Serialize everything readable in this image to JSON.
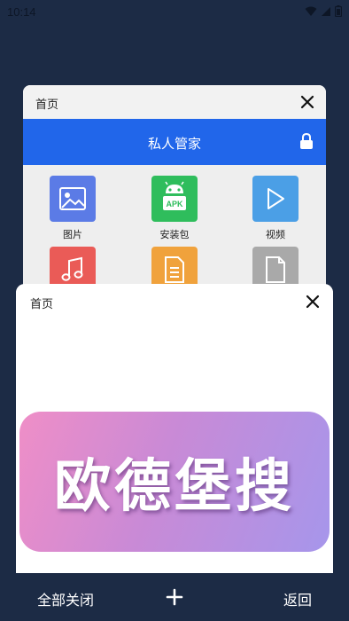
{
  "status_bar": {
    "time": "10:14",
    "icons": [
      "wifi-icon",
      "signal-icon",
      "battery-icon"
    ]
  },
  "back_card": {
    "title": "首页",
    "close_icon": "close-icon",
    "app_title": "私人管家",
    "lock_icon": "lock-icon",
    "accent": "#2166ea",
    "items": [
      {
        "label": "图片",
        "icon": "image-icon",
        "color": "#5b7be6"
      },
      {
        "label": "安装包",
        "icon": "android-apk-icon",
        "color": "#2fbd5c",
        "badge": "APK"
      },
      {
        "label": "视频",
        "icon": "play-icon",
        "color": "#4b9fe6"
      },
      {
        "label": "",
        "icon": "music-icon",
        "color": "#ea5b57"
      },
      {
        "label": "",
        "icon": "document-icon",
        "color": "#f0a23c"
      },
      {
        "label": "",
        "icon": "file-icon",
        "color": "#a9a9a9"
      }
    ]
  },
  "front_card": {
    "title": "首页",
    "close_icon": "close-icon",
    "banner_text": "欧德堡搜"
  },
  "bottom_bar": {
    "close_all_label": "全部关闭",
    "add_icon": "plus-icon",
    "back_label": "返回"
  }
}
